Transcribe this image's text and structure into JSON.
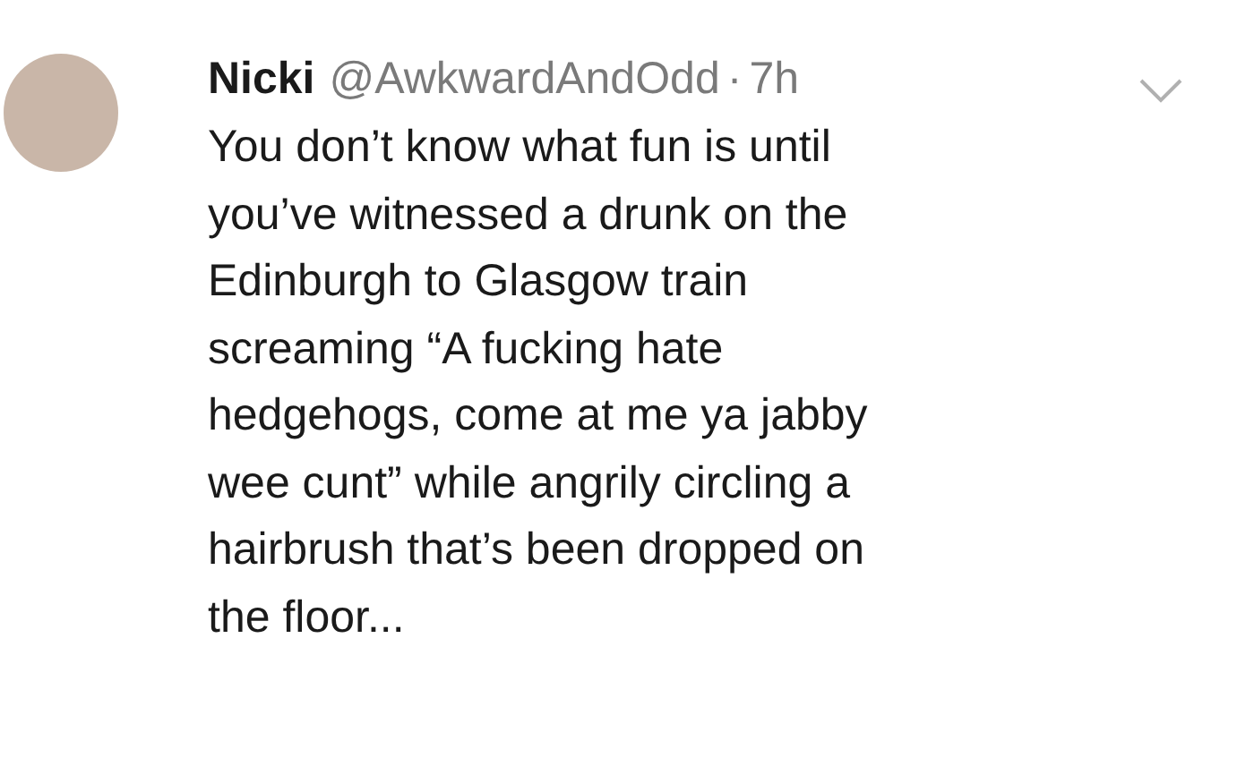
{
  "tweet": {
    "display_name": "Nicki",
    "handle": "@AwkwardAndOdd",
    "separator": "·",
    "time": "7h",
    "text_lines": [
      "You don’t know what fun is until",
      "you’ve witnessed a drunk on the",
      "Edinburgh to Glasgow train",
      "screaming “A fucking hate",
      "hedgehogs, come at me ya jabby",
      "wee cunt” while angrily circling a",
      "hairbrush that’s been dropped on",
      "the floor..."
    ]
  }
}
